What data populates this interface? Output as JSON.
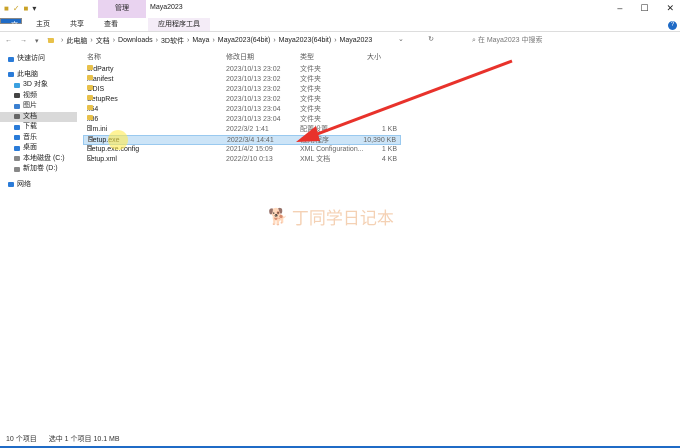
{
  "window": {
    "title": "Maya2023",
    "context_tab": "管理"
  },
  "ribbon": {
    "tabs": [
      "文件",
      "主页",
      "共享",
      "查看",
      "应用程序工具"
    ]
  },
  "address": {
    "crumbs": [
      "此电脑",
      "文档",
      "Downloads",
      "3D软件",
      "Maya",
      "Maya2023(64bit)",
      "Maya2023(64bit)",
      "Maya2023"
    ],
    "search_placeholder": "在 Maya2023 中搜索"
  },
  "sidebar": {
    "items": [
      {
        "label": "快速访问",
        "head": true,
        "color": "#2a7bd8"
      },
      {
        "label": "此电脑",
        "head": true,
        "color": "#2a7bd8"
      },
      {
        "label": "3D 对象",
        "color": "#3aa0e0"
      },
      {
        "label": "视频",
        "color": "#444"
      },
      {
        "label": "图片",
        "color": "#3a7fd0"
      },
      {
        "label": "文档",
        "color": "#666",
        "active": true
      },
      {
        "label": "下载",
        "color": "#2a7bd8"
      },
      {
        "label": "音乐",
        "color": "#2a7bd8"
      },
      {
        "label": "桌面",
        "color": "#2a7bd8"
      },
      {
        "label": "本地磁盘 (C:)",
        "color": "#888"
      },
      {
        "label": "新加卷 (D:)",
        "color": "#888"
      },
      {
        "label": "网络",
        "head": true,
        "color": "#2a7bd8"
      }
    ]
  },
  "columns": {
    "name": "名称",
    "date": "修改日期",
    "type": "类型",
    "size": "大小"
  },
  "files": [
    {
      "name": "3rdParty",
      "date": "2023/10/13 23:02",
      "type": "文件夹",
      "size": "",
      "folder": true
    },
    {
      "name": "manifest",
      "date": "2023/10/13 23:02",
      "type": "文件夹",
      "size": "",
      "folder": true
    },
    {
      "name": "ODIS",
      "date": "2023/10/13 23:02",
      "type": "文件夹",
      "size": "",
      "folder": true
    },
    {
      "name": "SetupRes",
      "date": "2023/10/13 23:02",
      "type": "文件夹",
      "size": "",
      "folder": true
    },
    {
      "name": "x64",
      "date": "2023/10/13 23:04",
      "type": "文件夹",
      "size": "",
      "folder": true
    },
    {
      "name": "x86",
      "date": "2023/10/13 23:04",
      "type": "文件夹",
      "size": "",
      "folder": true
    },
    {
      "name": "dlm.ini",
      "date": "2022/3/2 1:41",
      "type": "配置设置",
      "size": "1 KB"
    },
    {
      "name": "Setup.exe",
      "date": "2022/3/4 14:41",
      "type": "应用程序",
      "size": "10,390 KB",
      "selected": true
    },
    {
      "name": "Setup.exe.config",
      "date": "2021/4/2 15:09",
      "type": "XML Configuration...",
      "size": "1 KB"
    },
    {
      "name": "setup.xml",
      "date": "2022/2/10 0:13",
      "type": "XML 文档",
      "size": "4 KB"
    }
  ],
  "status": {
    "count": "10 个项目",
    "selection": "选中 1 个项目  10.1 MB"
  },
  "watermark": "丁同学日记本",
  "colors": {
    "accent": "#1f6bc6",
    "arrow": "#e8322b",
    "selection": "#cce4f7"
  }
}
